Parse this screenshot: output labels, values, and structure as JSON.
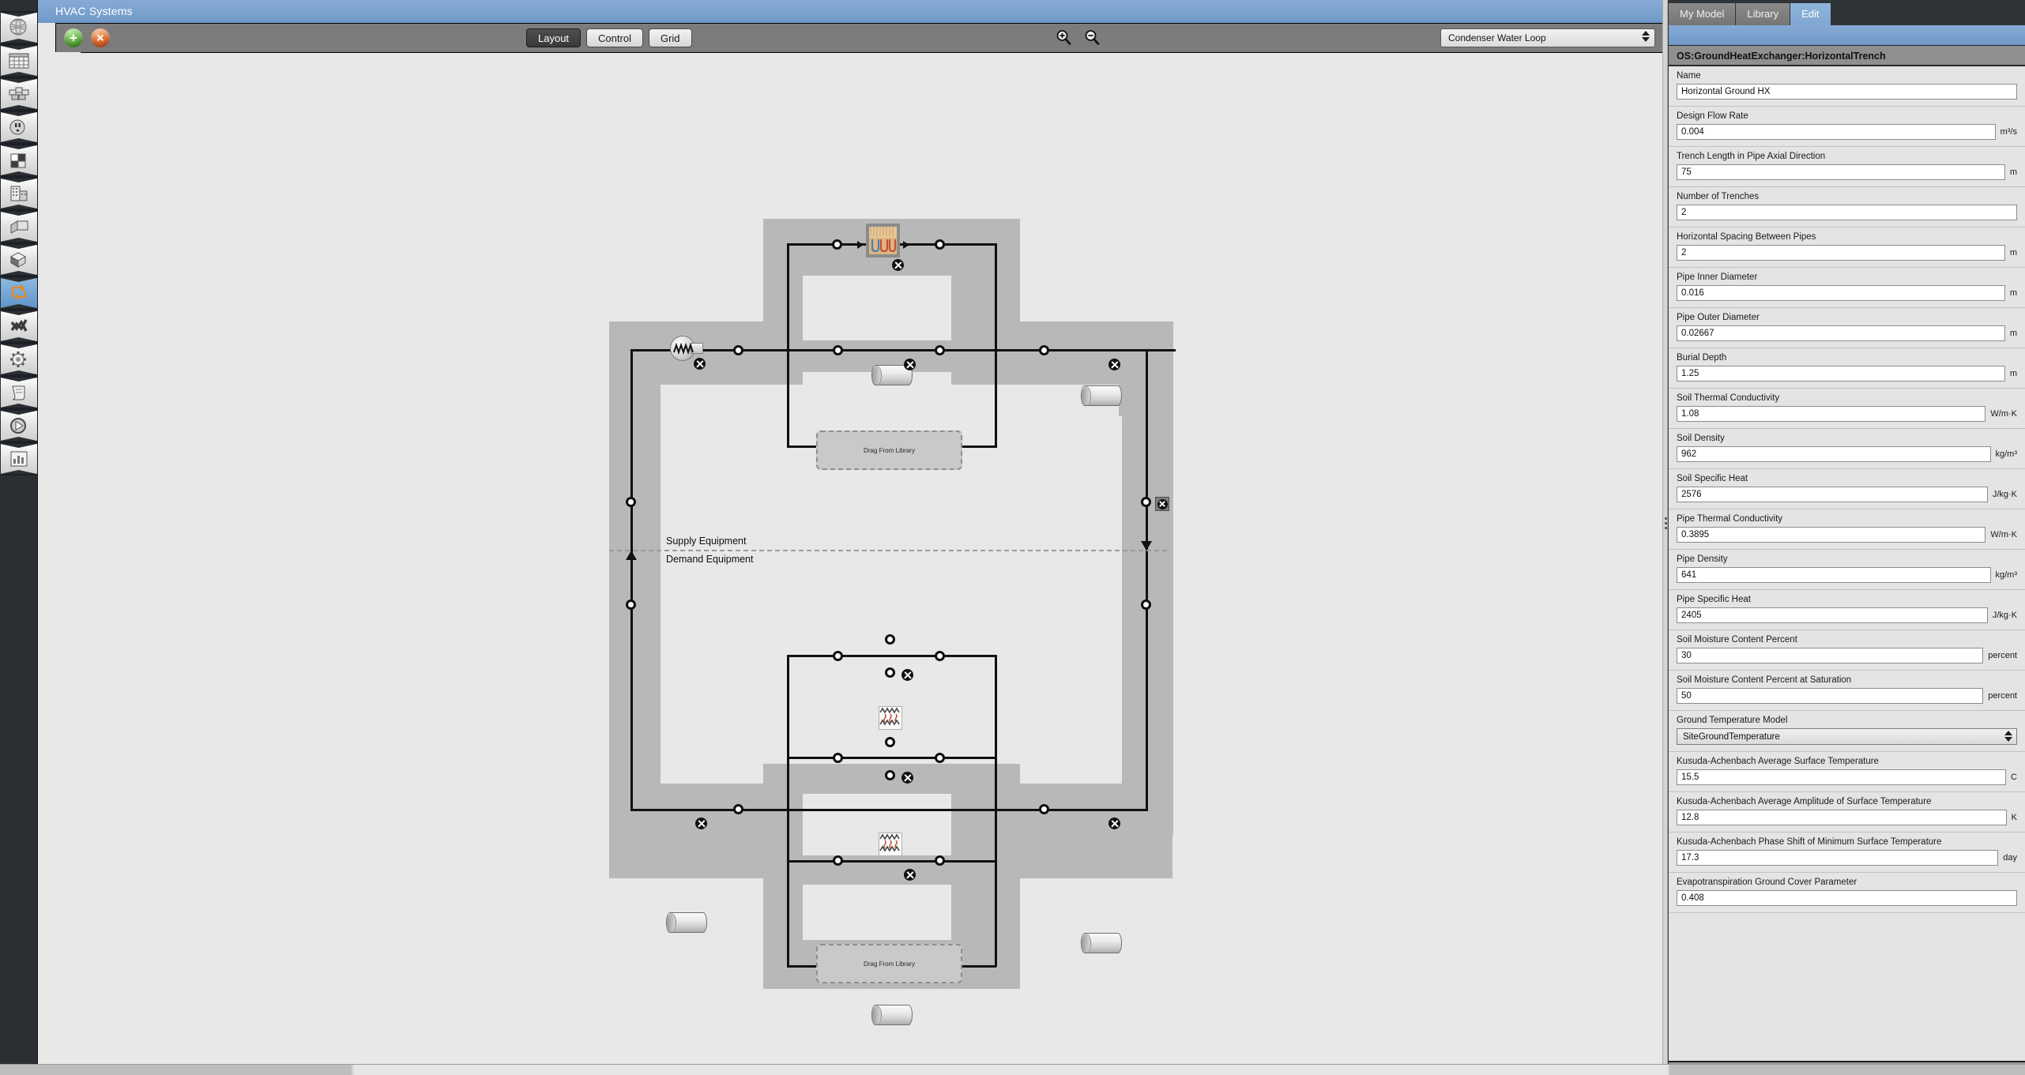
{
  "window": {
    "title": "HVAC Systems"
  },
  "left_rail": {
    "items": [
      {
        "name": "site-icon",
        "label": "Site"
      },
      {
        "name": "schedules-icon",
        "label": "Schedules"
      },
      {
        "name": "constructions-icon",
        "label": "Constructions"
      },
      {
        "name": "loads-icon",
        "label": "Loads"
      },
      {
        "name": "space-types-icon",
        "label": "Space Types"
      },
      {
        "name": "facility-icon",
        "label": "Facility"
      },
      {
        "name": "spaces-icon",
        "label": "Spaces"
      },
      {
        "name": "thermal-zones-icon",
        "label": "Thermal Zones"
      },
      {
        "name": "hvac-systems-icon",
        "label": "HVAC Systems"
      },
      {
        "name": "measures-icon",
        "label": "Measures"
      },
      {
        "name": "simulation-settings-icon",
        "label": "Simulation Settings"
      },
      {
        "name": "scripts-icon",
        "label": "Scripts"
      },
      {
        "name": "run-simulation-icon",
        "label": "Run Simulation"
      },
      {
        "name": "results-summary-icon",
        "label": "Results Summary"
      }
    ],
    "selected_index": 8
  },
  "toolbar": {
    "add_label": "+",
    "remove_label": "✕",
    "add_name": "add-loop-button",
    "remove_name": "remove-loop-button",
    "segments": [
      {
        "label": "Layout",
        "active": true
      },
      {
        "label": "Control",
        "active": false
      },
      {
        "label": "Grid",
        "active": false
      }
    ],
    "zoom_in_title": "Zoom In",
    "zoom_out_title": "Zoom Out",
    "loop_selector_value": "Condenser Water Loop"
  },
  "canvas": {
    "supply_label": "Supply Equipment",
    "demand_label": "Demand Equipment",
    "dropzone_label": "Drag From Library",
    "components": [
      {
        "name": "ground-heat-exchanger-horizontal-trench",
        "kind": "trench"
      },
      {
        "name": "pump-variable-speed",
        "kind": "pump"
      },
      {
        "name": "pipe-adiabatic-supply-bypass",
        "kind": "pipe"
      },
      {
        "name": "pipe-adiabatic-supply-outlet",
        "kind": "pipe"
      },
      {
        "name": "water-to-water-heat-pump-1",
        "kind": "heat-exchanger"
      },
      {
        "name": "water-to-water-heat-pump-2",
        "kind": "heat-exchanger"
      },
      {
        "name": "pipe-adiabatic-demand-inlet",
        "kind": "pipe"
      },
      {
        "name": "pipe-adiabatic-demand-outlet",
        "kind": "pipe"
      },
      {
        "name": "pipe-adiabatic-demand-bypass",
        "kind": "pipe"
      }
    ]
  },
  "right_panel": {
    "tabs": [
      {
        "label": "My Model",
        "active": false
      },
      {
        "label": "Library",
        "active": false
      },
      {
        "label": "Edit",
        "active": true
      }
    ],
    "object_type": "OS:GroundHeatExchanger:HorizontalTrench",
    "fields": [
      {
        "label": "Name",
        "value": "Horizontal Ground HX",
        "unit": "",
        "type": "text",
        "name": "name-field"
      },
      {
        "label": "Design Flow Rate",
        "value": "0.004",
        "unit": "m³/s",
        "type": "text",
        "name": "design-flow-rate-field"
      },
      {
        "label": "Trench Length in Pipe Axial Direction",
        "value": "75",
        "unit": "m",
        "type": "text",
        "name": "trench-length-field"
      },
      {
        "label": "Number of Trenches",
        "value": "2",
        "unit": "",
        "type": "text",
        "name": "number-of-trenches-field"
      },
      {
        "label": "Horizontal Spacing Between Pipes",
        "value": "2",
        "unit": "m",
        "type": "text",
        "name": "horizontal-spacing-field"
      },
      {
        "label": "Pipe Inner Diameter",
        "value": "0.016",
        "unit": "m",
        "type": "text",
        "name": "pipe-inner-diameter-field"
      },
      {
        "label": "Pipe Outer Diameter",
        "value": "0.02667",
        "unit": "m",
        "type": "text",
        "name": "pipe-outer-diameter-field"
      },
      {
        "label": "Burial Depth",
        "value": "1.25",
        "unit": "m",
        "type": "text",
        "name": "burial-depth-field"
      },
      {
        "label": "Soil Thermal Conductivity",
        "value": "1.08",
        "unit": "W/m·K",
        "type": "text",
        "name": "soil-thermal-conductivity-field"
      },
      {
        "label": "Soil Density",
        "value": "962",
        "unit": "kg/m³",
        "type": "text",
        "name": "soil-density-field"
      },
      {
        "label": "Soil Specific Heat",
        "value": "2576",
        "unit": "J/kg·K",
        "type": "text",
        "name": "soil-specific-heat-field"
      },
      {
        "label": "Pipe Thermal Conductivity",
        "value": "0.3895",
        "unit": "W/m·K",
        "type": "text",
        "name": "pipe-thermal-conductivity-field"
      },
      {
        "label": "Pipe Density",
        "value": "641",
        "unit": "kg/m³",
        "type": "text",
        "name": "pipe-density-field"
      },
      {
        "label": "Pipe Specific Heat",
        "value": "2405",
        "unit": "J/kg·K",
        "type": "text",
        "name": "pipe-specific-heat-field"
      },
      {
        "label": "Soil Moisture Content Percent",
        "value": "30",
        "unit": "percent",
        "type": "text",
        "name": "soil-moisture-content-field"
      },
      {
        "label": "Soil Moisture Content Percent at Saturation",
        "value": "50",
        "unit": "percent",
        "type": "text",
        "name": "soil-moisture-saturation-field"
      },
      {
        "label": "Ground Temperature Model",
        "value": "SiteGroundTemperature",
        "unit": "",
        "type": "select",
        "name": "ground-temperature-model-select"
      },
      {
        "label": "Kusuda-Achenbach Average Surface Temperature",
        "value": "15.5",
        "unit": "C",
        "type": "text",
        "name": "kusuda-avg-surface-temp-field"
      },
      {
        "label": "Kusuda-Achenbach Average Amplitude of Surface Temperature",
        "value": "12.8",
        "unit": "K",
        "type": "text",
        "name": "kusuda-amplitude-field"
      },
      {
        "label": "Kusuda-Achenbach Phase Shift of Minimum Surface Temperature",
        "value": "17.3",
        "unit": "day",
        "type": "text",
        "name": "kusuda-phase-shift-field"
      },
      {
        "label": "Evapotranspiration Ground Cover Parameter",
        "value": "0.408",
        "unit": "",
        "type": "text",
        "name": "evapotranspiration-field"
      }
    ]
  }
}
